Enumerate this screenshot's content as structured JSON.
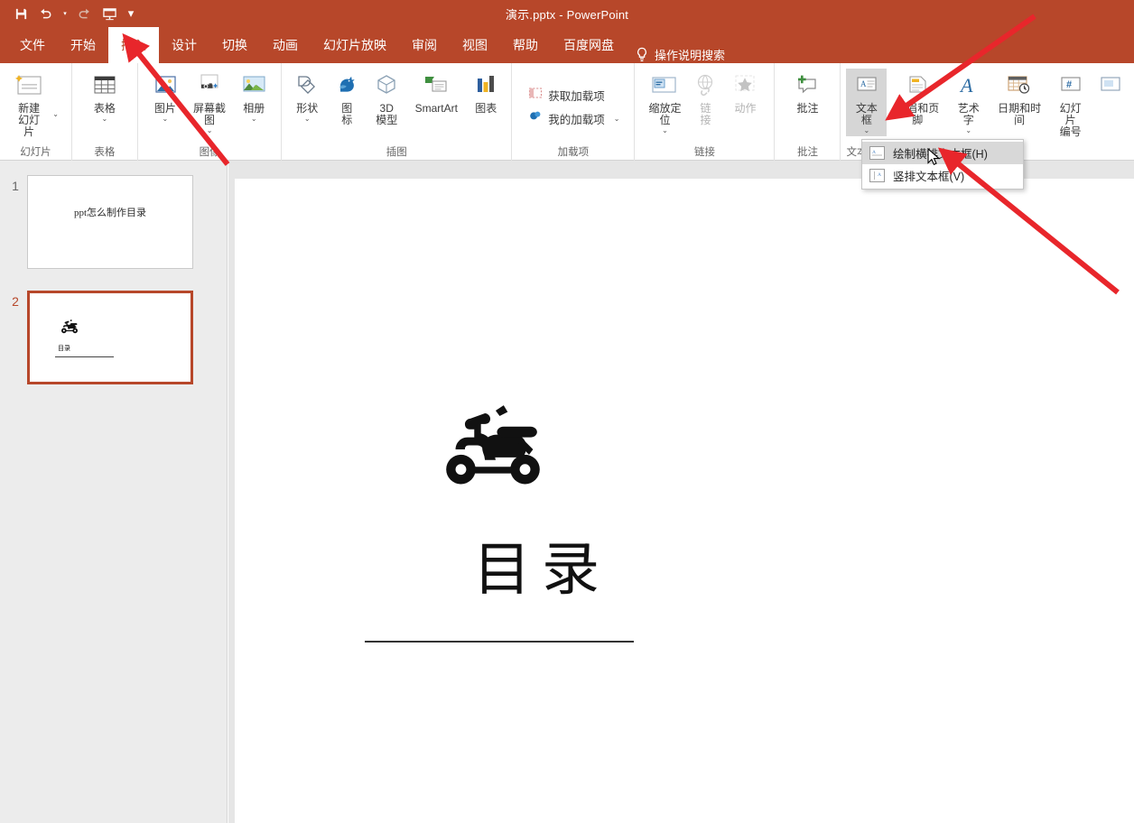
{
  "window": {
    "title": "演示.pptx  -  PowerPoint",
    "accent_color": "#B7472A"
  },
  "quick_access": {
    "items": [
      {
        "name": "save-icon",
        "label": "保存"
      },
      {
        "name": "undo-icon",
        "label": "撤消"
      },
      {
        "name": "redo-icon",
        "label": "恢复"
      },
      {
        "name": "start-slideshow-icon",
        "label": "从头开始"
      },
      {
        "name": "customize-quick-access-icon",
        "label": "自定义快速访问工具栏"
      }
    ]
  },
  "ribbon": {
    "tabs": [
      {
        "label": "文件",
        "active": false
      },
      {
        "label": "开始",
        "active": false
      },
      {
        "label": "插入",
        "active": true
      },
      {
        "label": "设计",
        "active": false
      },
      {
        "label": "切换",
        "active": false
      },
      {
        "label": "动画",
        "active": false
      },
      {
        "label": "幻灯片放映",
        "active": false
      },
      {
        "label": "审阅",
        "active": false
      },
      {
        "label": "视图",
        "active": false
      },
      {
        "label": "帮助",
        "active": false
      },
      {
        "label": "百度网盘",
        "active": false
      }
    ],
    "tell_me": "操作说明搜索",
    "groups": [
      {
        "label": "幻灯片",
        "items": [
          {
            "label": "新建\n幻灯片",
            "caret": true,
            "disabled": false
          }
        ]
      },
      {
        "label": "表格",
        "items": [
          {
            "label": "表格",
            "caret": true,
            "disabled": false
          }
        ]
      },
      {
        "label": "图像",
        "items": [
          {
            "label": "图片",
            "caret": true,
            "disabled": false
          },
          {
            "label": "屏幕截图",
            "caret": true,
            "disabled": false
          },
          {
            "label": "相册",
            "caret": true,
            "disabled": false
          }
        ]
      },
      {
        "label": "插图",
        "items": [
          {
            "label": "形状",
            "caret": true,
            "disabled": false
          },
          {
            "label": "图\n标",
            "caret": false,
            "disabled": false
          },
          {
            "label": "3D\n模型",
            "caret": false,
            "disabled": false
          },
          {
            "label": "SmartArt",
            "caret": false,
            "disabled": false
          },
          {
            "label": "图表",
            "caret": false,
            "disabled": false
          }
        ]
      },
      {
        "label": "加载项",
        "items": [
          {
            "label": "获取加载项",
            "caret": false,
            "disabled": false
          },
          {
            "label": "我的加载项",
            "caret": true,
            "disabled": false
          }
        ]
      },
      {
        "label": "链接",
        "items": [
          {
            "label": "缩放定\n位",
            "caret": true,
            "disabled": false
          },
          {
            "label": "链\n接",
            "caret": false,
            "disabled": true
          },
          {
            "label": "动作",
            "caret": false,
            "disabled": true
          }
        ]
      },
      {
        "label": "批注",
        "items": [
          {
            "label": "批注",
            "caret": false,
            "disabled": false
          }
        ]
      },
      {
        "label": "文本",
        "items": [
          {
            "label": "文本框",
            "caret": true,
            "disabled": false,
            "pressed": true
          },
          {
            "label": "页眉和页脚",
            "caret": false,
            "disabled": false
          },
          {
            "label": "艺术字",
            "caret": true,
            "disabled": false
          },
          {
            "label": "日期和时间",
            "caret": false,
            "disabled": false
          },
          {
            "label": "幻灯片\n编号",
            "caret": false,
            "disabled": false
          }
        ]
      }
    ]
  },
  "textbox_menu": {
    "items": [
      {
        "label": "绘制横排文本框(H)",
        "highlighted": true,
        "icon": "horizontal-textbox-icon"
      },
      {
        "label": "竖排文本框(V)",
        "highlighted": false,
        "icon": "vertical-textbox-icon"
      }
    ]
  },
  "slides_pane": {
    "slides": [
      {
        "number": "1",
        "selected": false,
        "title": "ppt怎么制作目录"
      },
      {
        "number": "2",
        "selected": true,
        "title": "目录"
      }
    ]
  },
  "slide_canvas": {
    "title": "目录",
    "graphic": "scooter-icon"
  },
  "annotations": {
    "arrows": [
      {
        "name": "arrow-to-insert-tab",
        "color": "#E8262B"
      },
      {
        "name": "arrow-to-textbox-button",
        "color": "#E8262B"
      },
      {
        "name": "arrow-to-draw-horizontal-textbox",
        "color": "#E8262B"
      }
    ]
  }
}
